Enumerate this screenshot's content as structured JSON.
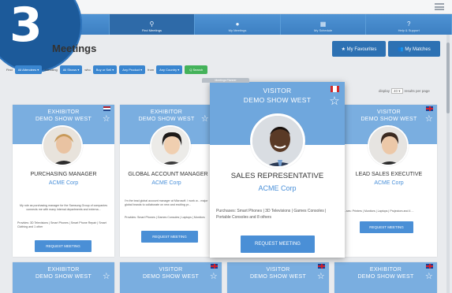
{
  "step_number": "3",
  "nav": {
    "items": [
      {
        "label": "Exhibitor Directory",
        "icon": "directory-icon",
        "glyph": "▤"
      },
      {
        "label": "Find Meetings",
        "icon": "search-icon",
        "glyph": "⚲"
      },
      {
        "label": "My Meetings",
        "icon": "chat-bubbles-icon",
        "glyph": "●"
      },
      {
        "label": "My Schedule",
        "icon": "calendar-icon",
        "glyph": "▦"
      },
      {
        "label": "Help & Support",
        "icon": "help-icon",
        "glyph": "?"
      }
    ]
  },
  "page": {
    "title": "Meetings",
    "favourites_label": "★ My Favourites",
    "matches_label": "👥 My Matches"
  },
  "filters": {
    "find_label": "Find",
    "attendees": "All Attendees ▾",
    "attending_label": "attending",
    "shows": "All Shows ▾",
    "who_label": "who",
    "buy_sell": "Buy or Sell ▾",
    "product": "Any Product ▾",
    "from_label": "from",
    "country": "Any Country ▾",
    "search_label": "Q Search"
  },
  "display": {
    "prefix": "display",
    "value": "40 ▾",
    "suffix": "results per page"
  },
  "cards": [
    {
      "type": "EXHIBITOR",
      "show": "DEMO SHOW WEST",
      "role": "PURCHASING MANAGER",
      "company": "ACME Corp",
      "desc": "My role as purchasing manager for the Samsung Group of companies connects me with many internal departments and externa...",
      "provides": "Provides: 3D Televisions | Smart Phones | Smart Phone Repair | Smart Clothing and 1 other",
      "button": "REQUEST MEETING",
      "flag": "nl"
    },
    {
      "type": "EXHIBITOR",
      "show": "DEMO SHOW WEST",
      "role": "GLOBAL ACCOUNT MANAGER",
      "company": "ACME Corp",
      "desc": "I'm the lead global account manager at Microsoft. I work w... major global brands to collaborate on new and exciting pr...",
      "provides": "Provides: Smart Phones | Games Consoles | Laptops | Monitors",
      "button": "REQUEST MEETING",
      "flag": ""
    },
    {
      "type": "VISITOR",
      "show": "DEMO SHOW WEST",
      "role": "LEAD SALES EXECUTIVE",
      "company": "ACME Corp",
      "provides": "...ses: Printers | Monitors | Laptops | Projectors and 4 ...",
      "button": "REQUEST MEETING",
      "flag": "uk"
    }
  ],
  "featured": {
    "tab_label": "Meetings Planner",
    "type": "VISITOR",
    "show": "DEMO SHOW WEST",
    "role": "SALES REPRESENTATIVE",
    "company": "ACME Corp",
    "provides": "Purchases: Smart Phones | 3D Televisions | Games Consoles | Portable Consoles and 8 others",
    "button": "REQUEST MEETING",
    "flag": "ca"
  },
  "bottom_cards": [
    {
      "type": "EXHIBITOR",
      "show": "DEMO SHOW WEST",
      "flag": ""
    },
    {
      "type": "VISITOR",
      "show": "DEMO SHOW WEST",
      "flag": "uk"
    },
    {
      "type": "VISITOR",
      "show": "DEMO SHOW WEST",
      "flag": "uk"
    },
    {
      "type": "EXHIBITOR",
      "show": "DEMO SHOW WEST",
      "flag": "uk"
    }
  ],
  "colors": {
    "nav": "#3c7fc2",
    "card_head": "#7aaee0",
    "button": "#4a8fd6",
    "search": "#44b25a",
    "badge": "#1c5a9a"
  }
}
